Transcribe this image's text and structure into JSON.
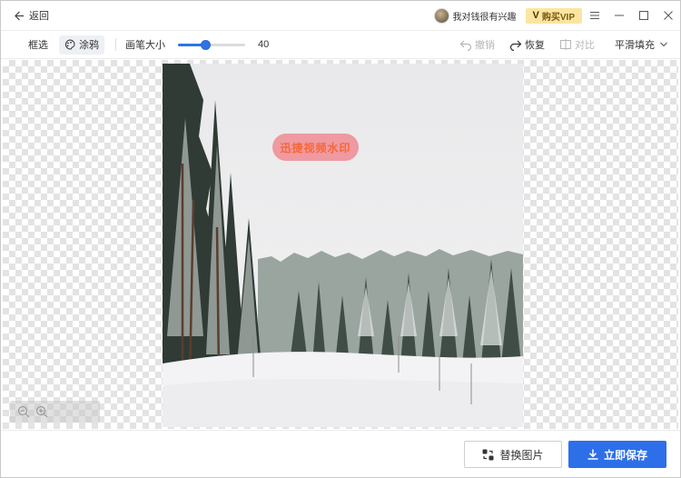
{
  "titlebar": {
    "back_label": "返回",
    "username": "我对钱很有兴趣",
    "vip_mark": "V",
    "vip_label": "购买VIP",
    "controls": [
      "menu-icon",
      "minimize-icon",
      "maximize-icon",
      "close-icon"
    ]
  },
  "toolbar": {
    "select_label": "框选",
    "brush_label": "涂鸦",
    "brush_size_label": "画笔大小",
    "brush_size_value": "40",
    "brush_size_fraction": 0.4,
    "undo_label": "撤销",
    "redo_label": "恢复",
    "compare_label": "对比",
    "fill_mode_label": "平滑填充"
  },
  "canvas": {
    "watermark_text": "迅捷视频水印",
    "zoom_controls": [
      "zoom-out-icon",
      "zoom-in-icon"
    ]
  },
  "footer": {
    "replace_label": "替换图片",
    "save_label": "立即保存"
  },
  "colors": {
    "accent": "#2d6fe8",
    "vip_bg": "#fbe5a0",
    "watermark_bg": "#f0828c",
    "watermark_text": "#f4683a"
  }
}
